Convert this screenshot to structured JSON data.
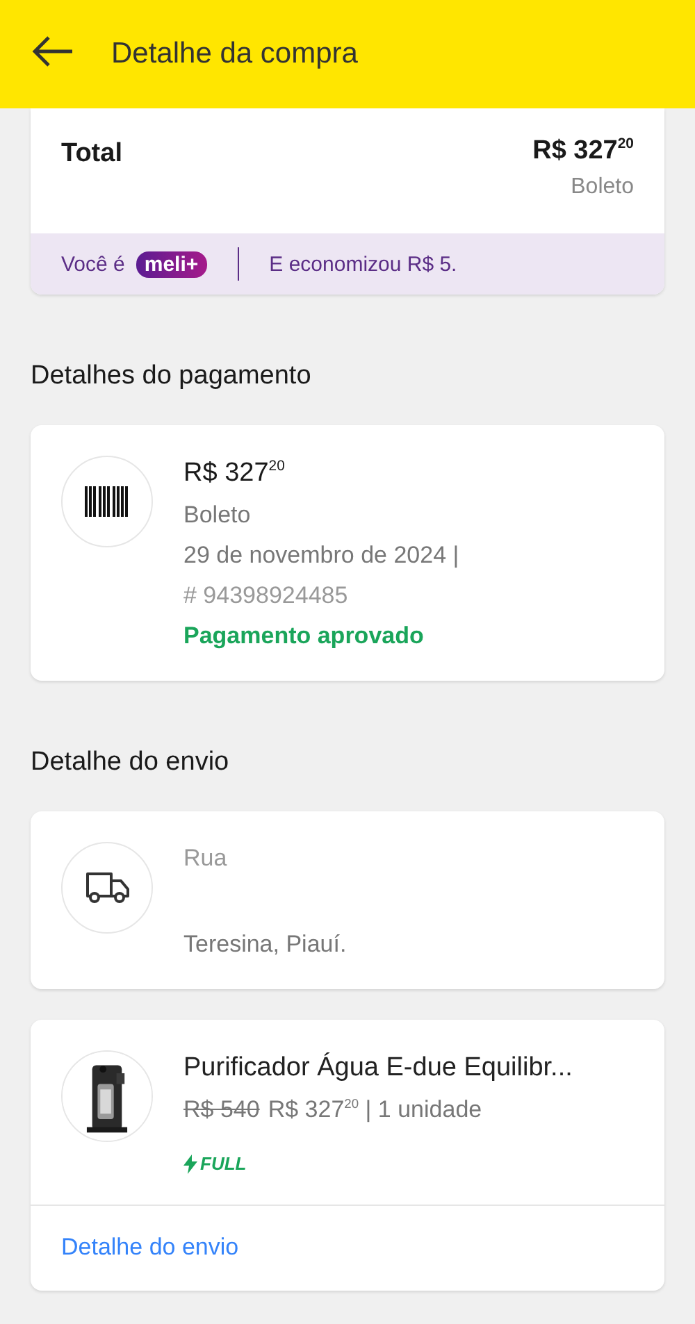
{
  "header": {
    "title": "Detalhe da compra"
  },
  "total_card": {
    "label": "Total",
    "amount": "R$ 327$^{20}$",
    "method": "Boleto",
    "membership": {
      "prefix": "Você é",
      "badge": "meli+",
      "savings": "E economizou R$ 5."
    }
  },
  "payment_section": {
    "title": "Detalhes do pagamento",
    "amount": "R$ 327$^{20}$",
    "method": "Boleto",
    "date": "29 de novembro de 2024  |",
    "reference": "# 94398924485",
    "status": "Pagamento aprovado"
  },
  "shipping_section": {
    "title": "Detalhe do envio",
    "address_line": "Rua",
    "city": "Teresina, Piauí."
  },
  "product": {
    "title": "Purificador Água E-due Equilibr...",
    "old_price": "R$ 540",
    "price": "R$ 327$^{20}$ | 1 unidade",
    "shipping_badge": "FULL",
    "link": "Detalhe do envio"
  }
}
